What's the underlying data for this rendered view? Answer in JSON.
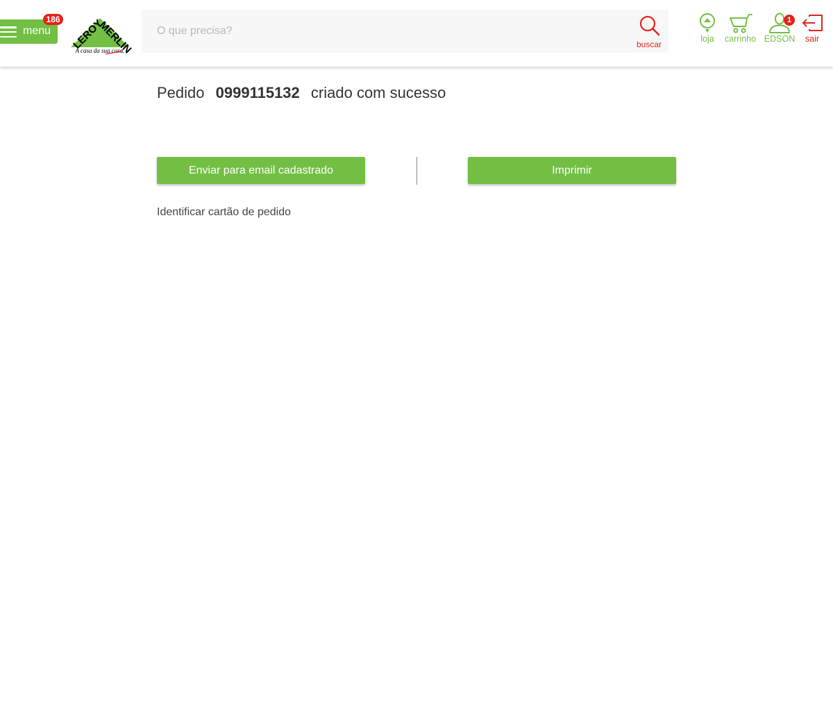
{
  "colors": {
    "brand_green": "#72bf44",
    "accent_red": "#e2231a",
    "text": "#333333",
    "search_bg": "#f7f7f7"
  },
  "header": {
    "menu": {
      "label": "menu",
      "badge": "186",
      "icon": "hamburger-icon"
    },
    "logo": {
      "brand": "LEROY MERLIN",
      "tagline": "A casa da sua casa."
    },
    "search": {
      "placeholder": "O que precisa?",
      "value": "",
      "button_label": "buscar",
      "icon": "magnifier-icon"
    },
    "actions": {
      "store": {
        "label": "loja",
        "icon": "store-pin-icon"
      },
      "cart": {
        "label": "carrinho",
        "icon": "cart-icon"
      },
      "user": {
        "label": "EDSON",
        "badge": "1",
        "icon": "user-icon"
      },
      "logout": {
        "label": "sair",
        "icon": "logout-icon"
      }
    }
  },
  "main": {
    "title": {
      "prefix": "Pedido",
      "order_number": "0999115132",
      "suffix": "criado com sucesso"
    },
    "buttons": {
      "send_email": "Enviar para email cadastrado",
      "print": "Imprimir"
    },
    "identify_card_link": "Identificar cartão de pedido"
  }
}
